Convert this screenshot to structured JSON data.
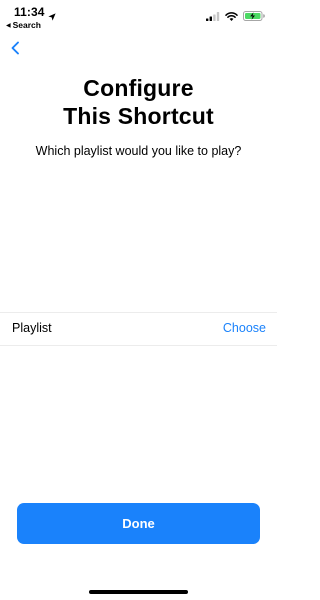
{
  "status_bar": {
    "time": "11:34",
    "back_app_label": "Search",
    "back_app_arrow": "◀",
    "icons": [
      "location-arrow-icon",
      "cellular-signal-icon",
      "wifi-icon",
      "battery-charging-icon"
    ],
    "battery_color": "#4cd964"
  },
  "nav": {
    "back_icon": "chevron-left-icon"
  },
  "header": {
    "title_line1": "Configure",
    "title_line2": "This Shortcut",
    "subtitle": "Which playlist would you like to play?"
  },
  "parameter": {
    "label": "Playlist",
    "action": "Choose"
  },
  "footer": {
    "done_label": "Done"
  },
  "colors": {
    "accent": "#1a82fb"
  }
}
